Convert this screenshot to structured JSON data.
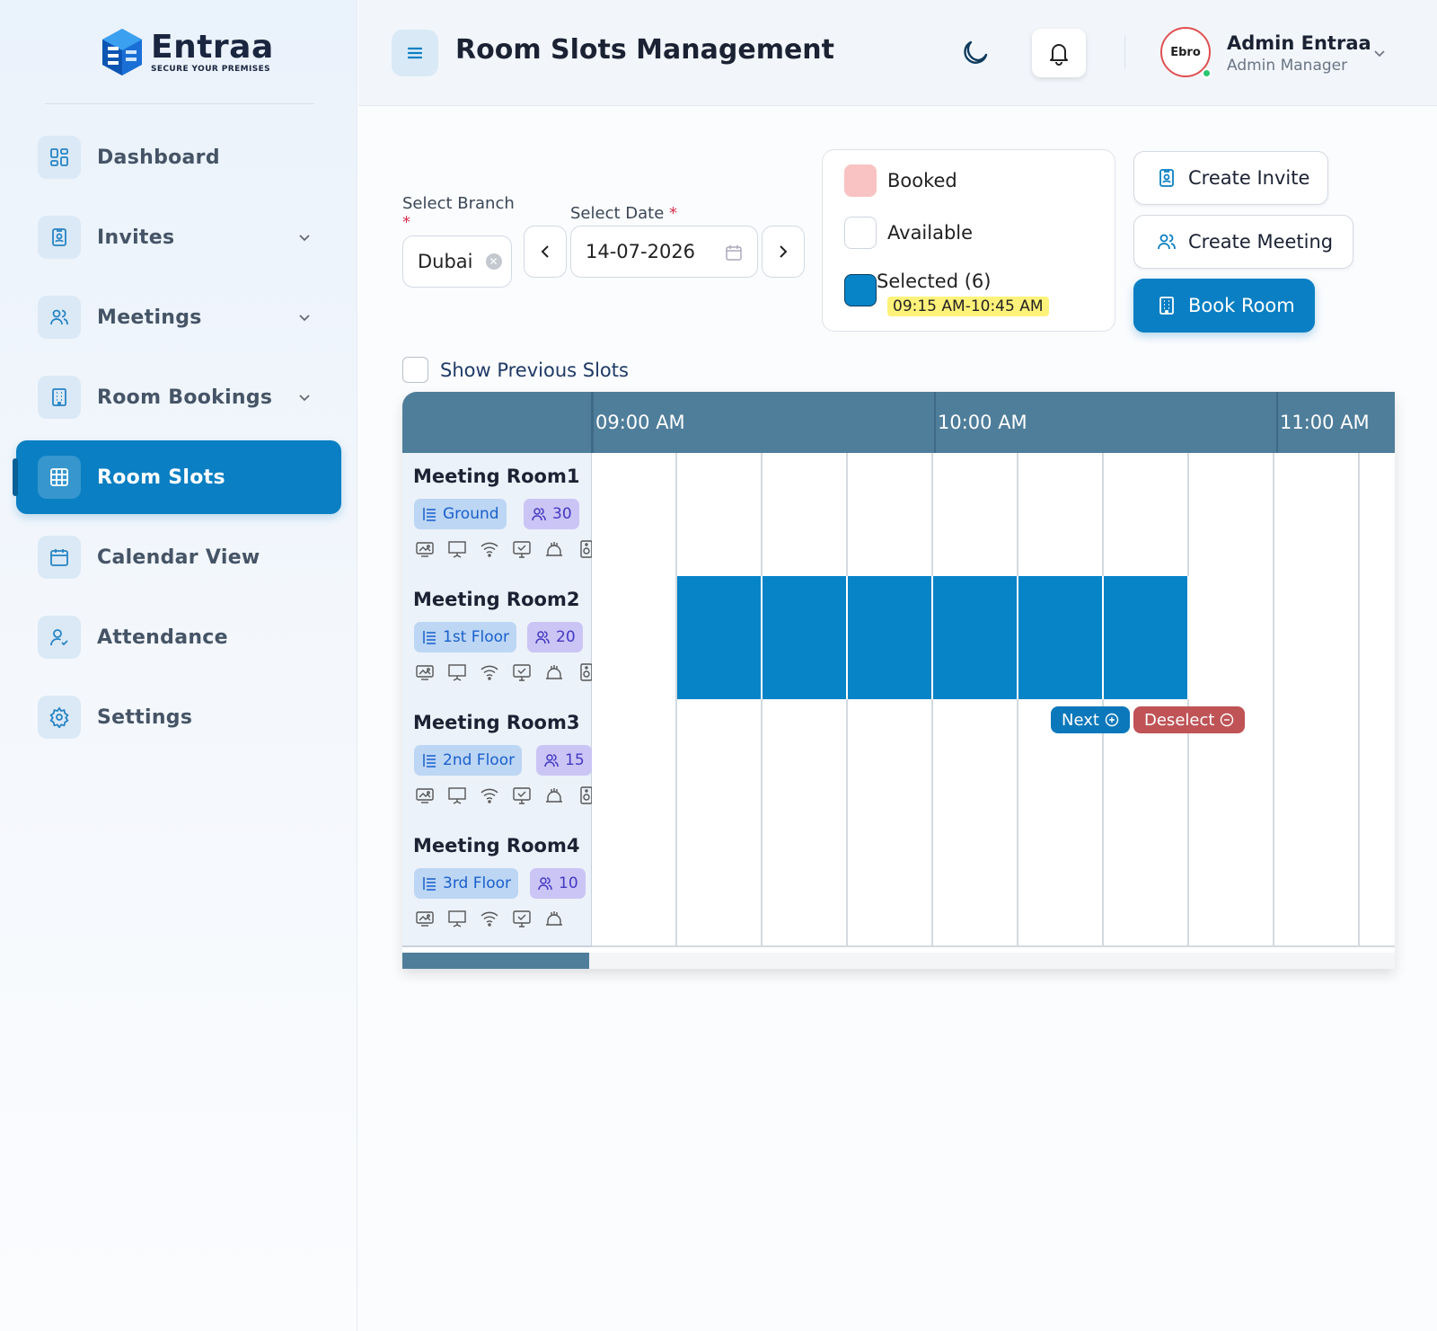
{
  "app": {
    "logo_name": "Entraa",
    "logo_tagline": "SECURE YOUR PREMISES",
    "page_title": "Room Slots Management"
  },
  "sidebar": {
    "items": [
      {
        "label": "Dashboard",
        "icon": "dashboard-icon",
        "expandable": false
      },
      {
        "label": "Invites",
        "icon": "id-badge-icon",
        "expandable": true
      },
      {
        "label": "Meetings",
        "icon": "users-icon",
        "expandable": true
      },
      {
        "label": "Room Bookings",
        "icon": "building-icon",
        "expandable": true
      },
      {
        "label": "Room Slots",
        "icon": "grid-icon",
        "expandable": false,
        "active": true
      },
      {
        "label": "Calendar View",
        "icon": "calendar-icon",
        "expandable": false
      },
      {
        "label": "Attendance",
        "icon": "user-check-icon",
        "expandable": false
      },
      {
        "label": "Settings",
        "icon": "gear-icon",
        "expandable": false
      }
    ]
  },
  "header": {
    "user_name": "Admin Entraa",
    "user_role": "Admin Manager",
    "avatar_text": "Ebro"
  },
  "filters": {
    "branch_label": "Select Branch",
    "branch_value": "Dubai",
    "date_label": "Select Date",
    "date_value": "14-07-2026",
    "required_mark": "*"
  },
  "legend": {
    "booked": "Booked",
    "available": "Available",
    "selected": "Selected (6)",
    "selected_range": "09:15 AM-10:45 AM",
    "colors": {
      "booked": "#f9c3c3",
      "available": "#ffffff",
      "selected": "#0784c8"
    }
  },
  "actions": {
    "create_invite": "Create Invite",
    "create_meeting": "Create Meeting",
    "book_room": "Book Room"
  },
  "show_previous_label": "Show Previous Slots",
  "timeline": {
    "hours": [
      "09:00 AM",
      "10:00 AM",
      "11:00 AM"
    ],
    "slot_minutes": 15,
    "rooms": [
      {
        "name": "Meeting Room1",
        "floor": "Ground",
        "capacity": "30",
        "amenities": [
          "projector-icon",
          "presentation-board-icon",
          "wifi-icon",
          "display-icon",
          "catering-icon",
          "speaker-icon"
        ]
      },
      {
        "name": "Meeting Room2",
        "floor": "1st Floor",
        "capacity": "20",
        "amenities": [
          "projector-icon",
          "presentation-board-icon",
          "wifi-icon",
          "display-icon",
          "catering-icon",
          "speaker-icon"
        ],
        "selected_slots": [
          "09:15 AM",
          "09:30 AM",
          "09:45 AM",
          "10:00 AM",
          "10:15 AM",
          "10:30 AM"
        ]
      },
      {
        "name": "Meeting Room3",
        "floor": "2nd Floor",
        "capacity": "15",
        "amenities": [
          "projector-icon",
          "presentation-board-icon",
          "wifi-icon",
          "display-icon",
          "catering-icon",
          "speaker-icon"
        ]
      },
      {
        "name": "Meeting Room4",
        "floor": "3rd Floor",
        "capacity": "10",
        "amenities": [
          "projector-icon",
          "presentation-board-icon",
          "wifi-icon",
          "display-icon",
          "catering-icon"
        ]
      }
    ],
    "next_label": "Next",
    "deselect_label": "Deselect"
  }
}
